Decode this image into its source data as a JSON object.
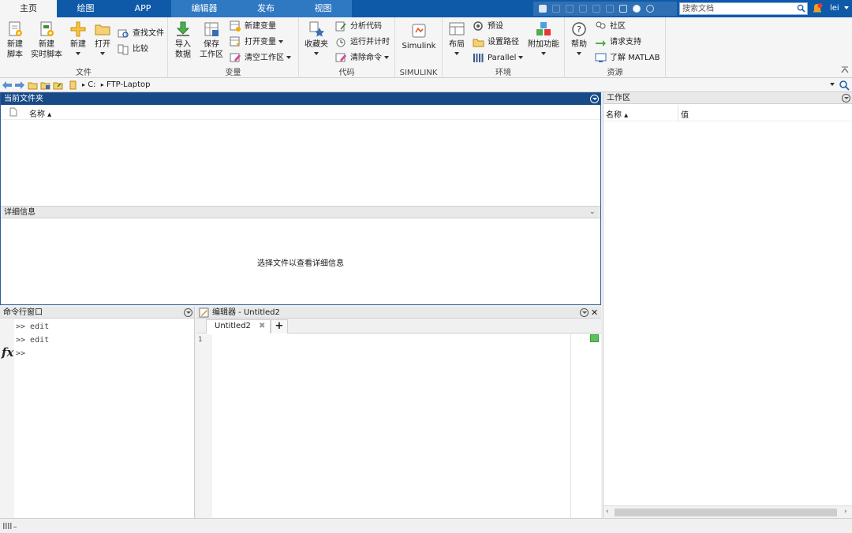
{
  "tabs": [
    "主页",
    "绘图",
    "APP",
    "编辑器",
    "发布",
    "视图"
  ],
  "search": {
    "placeholder": "搜索文档"
  },
  "user": "lei",
  "ribbon": {
    "file": {
      "label": "文件",
      "new_script": "新建\n脚本",
      "new_live_script": "新建\n实时脚本",
      "new": "新建",
      "open": "打开",
      "find_files": "查找文件",
      "compare": "比较"
    },
    "variable": {
      "label": "变量",
      "import_data": "导入\n数据",
      "save_workspace": "保存\n工作区",
      "new_variable": "新建变量",
      "open_variable": "打开变量",
      "clear_workspace": "清空工作区"
    },
    "code": {
      "label": "代码",
      "favorites": "收藏夹",
      "analyze_code": "分析代码",
      "run_and_time": "运行并计时",
      "clear_commands": "清除命令"
    },
    "simulink": {
      "label": "SIMULINK",
      "simulink": "Simulink"
    },
    "environment": {
      "label": "环境",
      "layout": "布局",
      "preferences": "预设",
      "set_path": "设置路径",
      "parallel": "Parallel",
      "add_ons": "附加功能"
    },
    "resources": {
      "label": "资源",
      "help": "帮助",
      "community": "社区",
      "request_support": "请求支持",
      "learn_matlab": "了解 MATLAB"
    }
  },
  "address": {
    "drive": "C:",
    "folder": "FTP-Laptop"
  },
  "current_folder": {
    "title": "当前文件夹",
    "name_col": "名称 ▴"
  },
  "details": {
    "title": "详细信息",
    "message": "选择文件以查看详细信息"
  },
  "workspace": {
    "title": "工作区",
    "name_col": "名称 ▴",
    "value_col": "值"
  },
  "command_window": {
    "title": "命令行窗口",
    "history": [
      ">> edit",
      ">> edit"
    ],
    "prompt": ">>",
    "fx": "fx"
  },
  "editor": {
    "title": "编辑器 - Untitled2",
    "tab": "Untitled2",
    "add_tab": "+",
    "line_number": "1"
  }
}
